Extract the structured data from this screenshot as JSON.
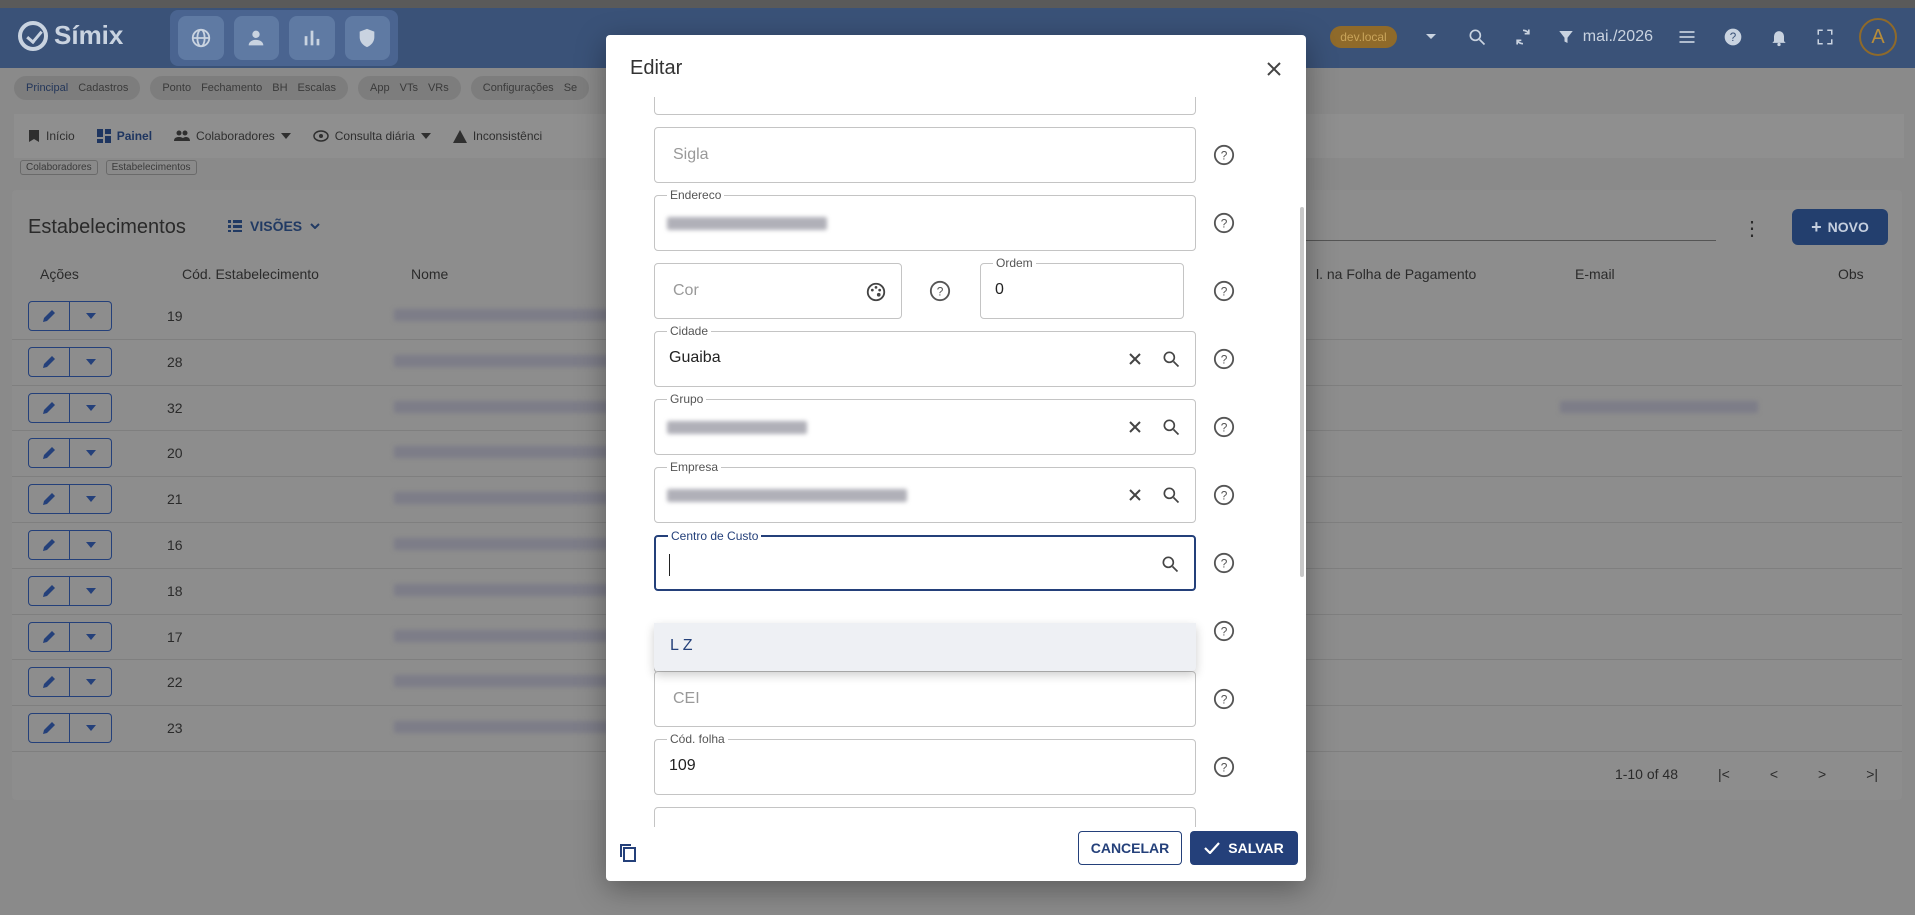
{
  "app": {
    "name": "Símix",
    "env_badge": "dev.local",
    "period": "mai./2026",
    "avatar_letter": "A"
  },
  "nav_groups": [
    [
      "Principal",
      "Cadastros"
    ],
    [
      "Ponto",
      "Fechamento",
      "BH",
      "Escalas"
    ],
    [
      "App",
      "VTs",
      "VRs"
    ],
    [
      "Configurações",
      "Se"
    ]
  ],
  "subnav": [
    "Início",
    "Painel",
    "Colaboradores",
    "Consulta diária",
    "Inconsistênci"
  ],
  "breadcrumbs": [
    "Colaboradores",
    "Estabelecimentos"
  ],
  "list": {
    "title": "Estabelecimentos",
    "visoes_label": "VISÕES",
    "novo_label": "NOVO",
    "columns": [
      "Ações",
      "Cód. Estabelecimento",
      "Nome",
      "l. na Folha de Pagamento",
      "E-mail",
      "Obs"
    ],
    "codes": [
      "19",
      "28",
      "32",
      "20",
      "21",
      "16",
      "18",
      "17",
      "22",
      "23"
    ],
    "pagination": "1-10 of 48"
  },
  "modal": {
    "title": "Editar",
    "fields": {
      "sigla_placeholder": "Sigla",
      "endereco_label": "Endereco",
      "cor_placeholder": "Cor",
      "ordem_label": "Ordem",
      "ordem_value": "0",
      "cidade_label": "Cidade",
      "cidade_value": "Guaiba",
      "grupo_label": "Grupo",
      "empresa_label": "Empresa",
      "centro_label": "Centro de Custo",
      "cei_placeholder": "CEI",
      "cod_folha_label": "Cód. folha",
      "cod_folha_value": "109"
    },
    "dropdown_option": "L Z",
    "cancel_label": "CANCELAR",
    "save_label": "SALVAR"
  }
}
